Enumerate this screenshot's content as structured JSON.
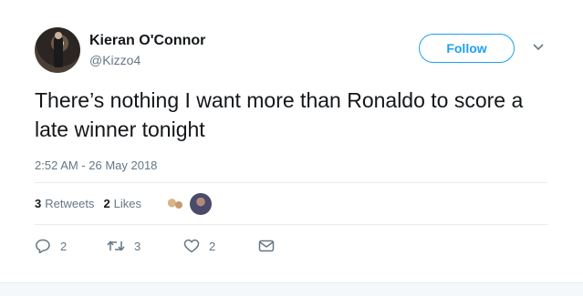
{
  "author": {
    "name": "Kieran O'Connor",
    "handle": "@Kizzo4"
  },
  "follow_label": "Follow",
  "tweet": {
    "text": "There’s nothing I want more than Ronaldo to score a late winner tonight",
    "timestamp": "2:52 AM - 26 May 2018"
  },
  "stats": {
    "retweets_count": "3",
    "retweets_label": "Retweets",
    "likes_count": "2",
    "likes_label": "Likes"
  },
  "actions": {
    "replies": "2",
    "retweets": "3",
    "likes": "2"
  },
  "icons": [
    "chevron-down-icon",
    "reply-icon",
    "retweet-icon",
    "heart-icon",
    "envelope-icon"
  ],
  "colors": {
    "accent": "#1da1f2",
    "secondary_text": "#657786",
    "primary_text": "#14171a",
    "divider": "#e6ecf0"
  }
}
